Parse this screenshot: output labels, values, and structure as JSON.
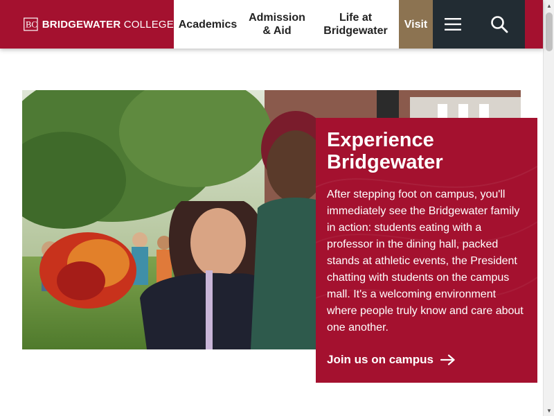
{
  "header": {
    "logo": {
      "mark": "BC",
      "name_bold": "BRIDGEWATER",
      "name_regular": "COLLEGE"
    },
    "nav": [
      {
        "label": "Academics"
      },
      {
        "label": "Admission & Aid"
      },
      {
        "label": "Life at Bridgewater"
      }
    ],
    "visit_label": "Visit",
    "menu_icon": "hamburger-menu-icon",
    "search_icon": "search-icon"
  },
  "hero": {
    "photo_icon": "photo"
  },
  "card": {
    "title": "Experience Bridgewater",
    "body": "After stepping foot on campus, you'll immediately see the Bridgewater family in action: students eating with a professor in the dining hall, packed stands at athletic events, the President chatting with students on the campus mall. It's a welcoming environment where people truly know and care about one another.",
    "cta_label": "Join us on campus",
    "cta_icon": "arrow-right-icon"
  },
  "colors": {
    "brand_crimson": "#a4112f",
    "visit_gold": "#8c7351",
    "dark_slate": "#222c33"
  }
}
